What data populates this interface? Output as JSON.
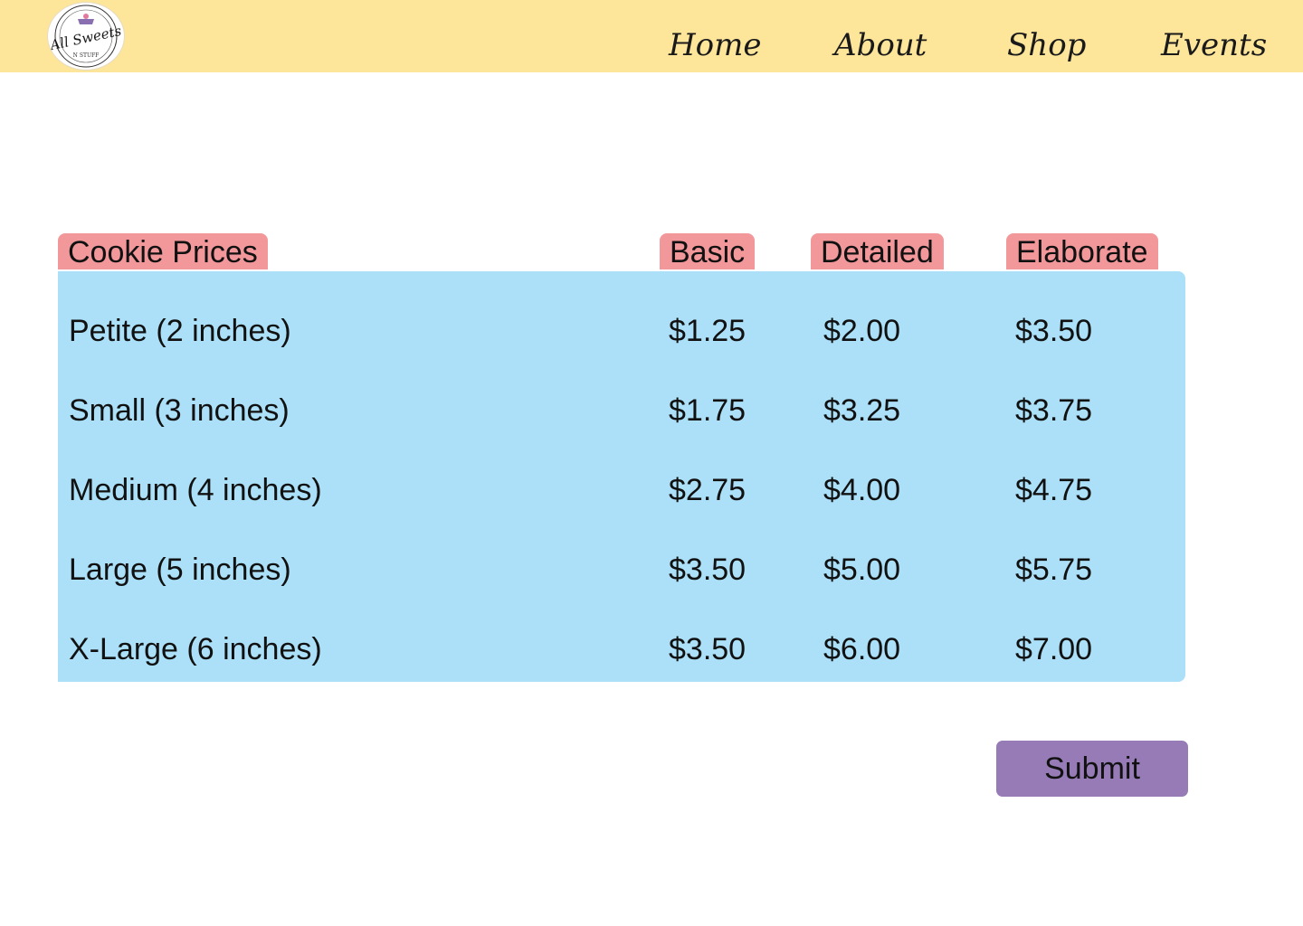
{
  "header": {
    "logo": {
      "text_main": "All Sweets",
      "text_sub": "N STUFF"
    },
    "nav": [
      "Home",
      "About",
      "Shop",
      "Events"
    ]
  },
  "table": {
    "title": "Cookie Prices",
    "columns": [
      "Basic",
      "Detailed",
      "Elaborate"
    ],
    "rows": [
      {
        "size": "Petite (2 inches)",
        "prices": [
          "$1.25",
          "$2.00",
          "$3.50"
        ]
      },
      {
        "size": "Small (3 inches)",
        "prices": [
          "$1.75",
          "$3.25",
          "$3.75"
        ]
      },
      {
        "size": "Medium (4 inches)",
        "prices": [
          "$2.75",
          "$4.00",
          "$4.75"
        ]
      },
      {
        "size": "Large (5 inches)",
        "prices": [
          "$3.50",
          "$5.00",
          "$5.75"
        ]
      },
      {
        "size": "X-Large (6 inches)",
        "prices": [
          "$3.50",
          "$6.00",
          "$7.00"
        ]
      }
    ]
  },
  "actions": {
    "submit_label": "Submit"
  },
  "colors": {
    "header_bg": "#fde59a",
    "tag_bg": "#f2989b",
    "panel_bg": "#abe0f8",
    "button_bg": "#967bb6"
  }
}
